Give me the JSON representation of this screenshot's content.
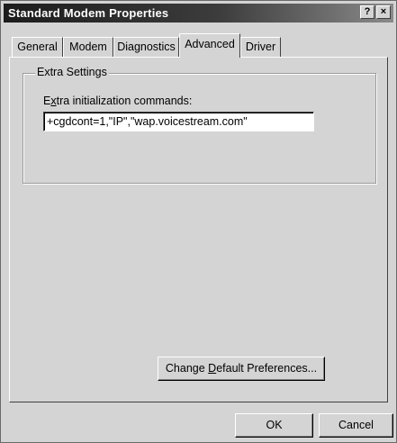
{
  "window": {
    "title": "Standard Modem Properties",
    "help_label": "?",
    "close_label": "×"
  },
  "tabs": [
    {
      "label": "General",
      "active": false
    },
    {
      "label": "Modem",
      "active": false
    },
    {
      "label": "Diagnostics",
      "active": false
    },
    {
      "label": "Advanced",
      "active": true
    },
    {
      "label": "Driver",
      "active": false
    }
  ],
  "advanced": {
    "group_title": "Extra Settings",
    "init_label_prefix": "E",
    "init_label_accel": "x",
    "init_label_rest": "tra initialization commands:",
    "init_value": "+cgdcont=1,\"IP\",\"wap.voicestream.com\"",
    "change_prefix": "Change ",
    "change_accel": "D",
    "change_rest": "efault Preferences..."
  },
  "footer": {
    "ok_label": "OK",
    "cancel_label": "Cancel"
  }
}
